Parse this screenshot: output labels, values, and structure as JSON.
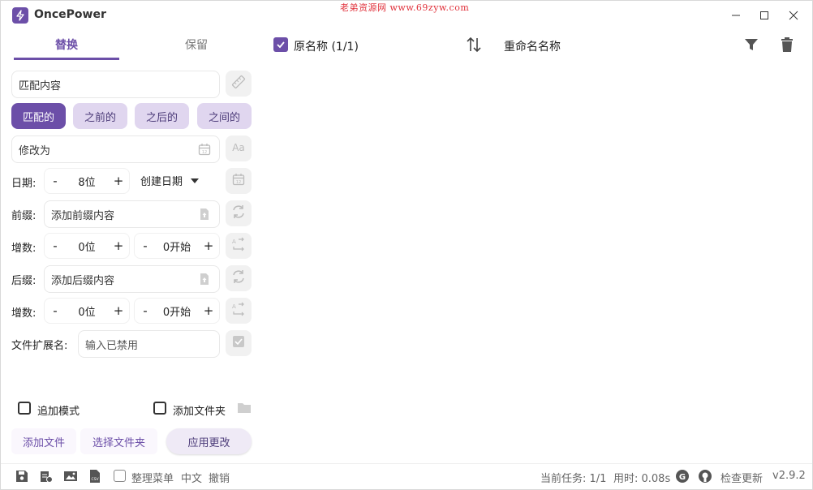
{
  "app": {
    "title": "OncePower",
    "watermark": "老弟资源网 www.69zyw.com",
    "accent": "#6c4fa8"
  },
  "tabs": [
    {
      "label": "替换",
      "active": true
    },
    {
      "label": "保留",
      "active": false
    }
  ],
  "match": {
    "placeholder": "匹配内容"
  },
  "modes": [
    "匹配的",
    "之前的",
    "之后的",
    "之间的"
  ],
  "modify": {
    "placeholder": "修改为"
  },
  "date": {
    "label": "日期:",
    "minus": "-",
    "value": "8位",
    "plus": "+",
    "type": "创建日期"
  },
  "prefix": {
    "label": "前缀:",
    "placeholder": "添加前缀内容"
  },
  "increment1": {
    "label": "增数:",
    "minus": "-",
    "digits": "0位",
    "plus": "+",
    "minus2": "-",
    "start": "0开始",
    "plus2": "+"
  },
  "suffix": {
    "label": "后缀:",
    "placeholder": "添加后缀内容"
  },
  "increment2": {
    "label": "增数:",
    "minus": "-",
    "digits": "0位",
    "plus": "+",
    "minus2": "-",
    "start": "0开始",
    "plus2": "+"
  },
  "extension": {
    "label": "文件扩展名:",
    "placeholder": "输入已禁用"
  },
  "options": {
    "append_mode": "追加模式",
    "add_folder": "添加文件夹"
  },
  "actions": {
    "add_file": "添加文件",
    "select_folder": "选择文件夹",
    "apply": "应用更改"
  },
  "list_header": {
    "original": "原名称 (1/1)",
    "renamed": "重命名名称"
  },
  "statusbar": {
    "organize_menu": "整理菜单",
    "language": "中文",
    "undo": "撤销",
    "task": "当前任务: 1/1",
    "time": "用时: 0.08s",
    "check_update": "检查更新",
    "version": "v2.9.2"
  }
}
